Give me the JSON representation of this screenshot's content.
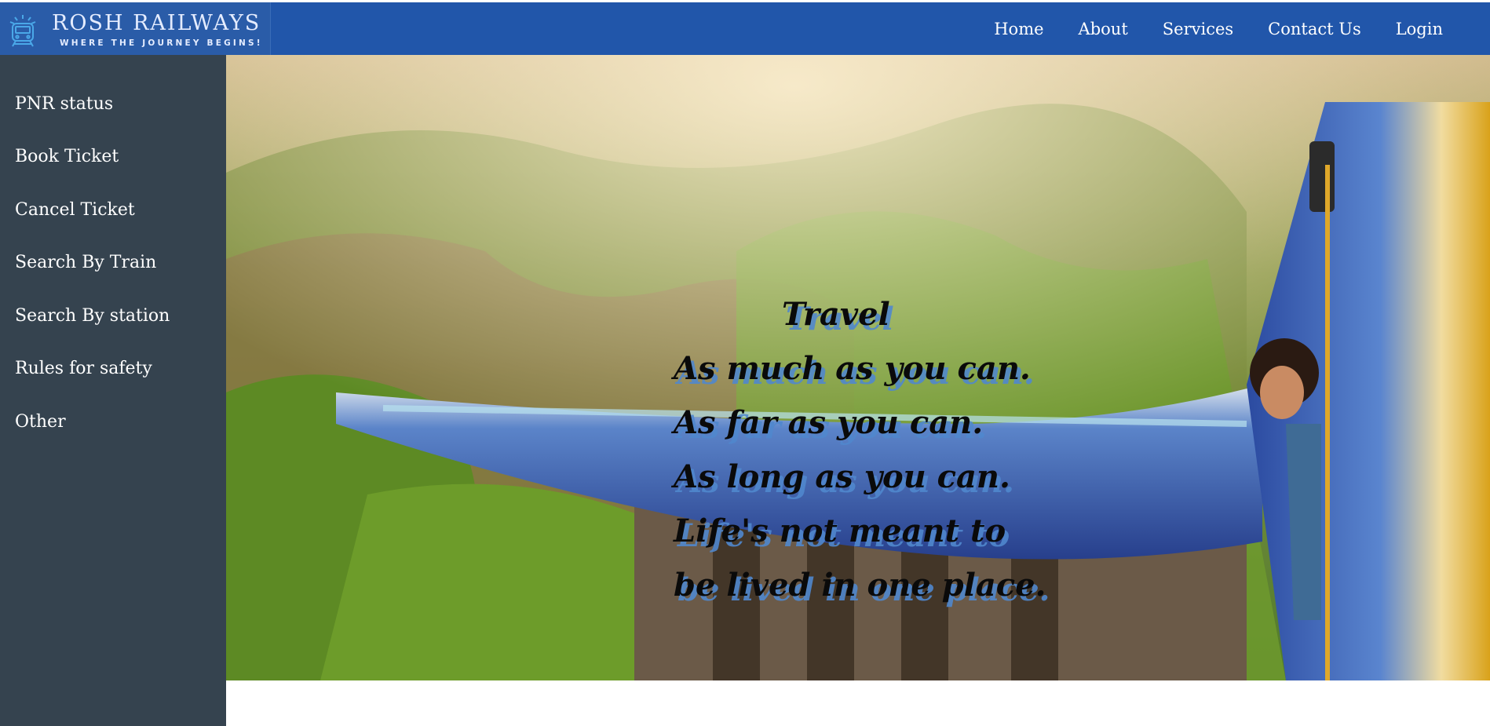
{
  "brand": {
    "title": "ROSH RAILWAYS",
    "tagline": "WHERE THE JOURNEY BEGINS!",
    "icon": "train-icon"
  },
  "nav": {
    "items": [
      {
        "label": "Home"
      },
      {
        "label": "About"
      },
      {
        "label": "Services"
      },
      {
        "label": "Contact Us"
      },
      {
        "label": "Login"
      }
    ]
  },
  "sidebar": {
    "items": [
      {
        "label": "PNR status"
      },
      {
        "label": "Book Ticket"
      },
      {
        "label": "Cancel Ticket"
      },
      {
        "label": "Search By Train"
      },
      {
        "label": "Search By station"
      },
      {
        "label": "Rules for safety"
      },
      {
        "label": "Other"
      }
    ]
  },
  "hero": {
    "quote": {
      "title": "Travel",
      "lines": [
        "As much as you can.",
        "As far as you can.",
        "As long as you can.",
        "Life's not meant to",
        "be lived in one place."
      ]
    }
  },
  "colors": {
    "header": "#2156aa",
    "sidebar": "#35434f",
    "text_shadow": "#5087cd"
  }
}
